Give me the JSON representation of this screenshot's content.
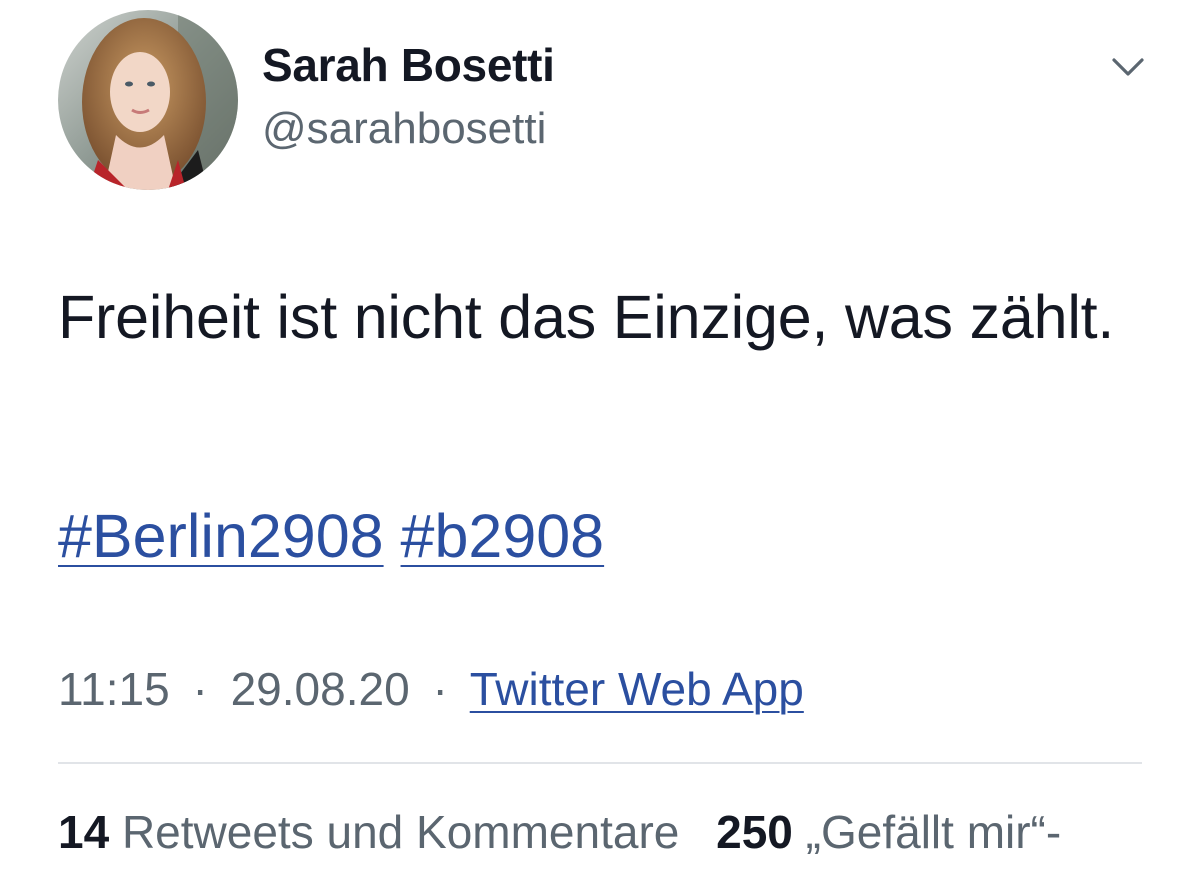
{
  "author": {
    "display_name": "Sarah Bosetti",
    "handle": "@sarahbosetti"
  },
  "icons": {
    "menu": "chevron-down-icon",
    "avatar": "profile-photo"
  },
  "tweet": {
    "text": "Freiheit ist nicht das Einzige, was zählt.",
    "hashtags": [
      "#Berlin2908",
      "#b2908"
    ]
  },
  "meta": {
    "time": "11:15",
    "separator_1": "·",
    "date": "29.08.20",
    "separator_2": "·",
    "source": "Twitter Web App"
  },
  "stats": {
    "retweets_count": "14",
    "retweets_label": "Retweets und Kommentare",
    "likes_count": "250",
    "likes_label": "„Gefällt mir“-"
  },
  "colors": {
    "link": "#2b4fa0",
    "text": "#141823",
    "secondary": "#5b6670",
    "divider": "#e1e4e8"
  }
}
